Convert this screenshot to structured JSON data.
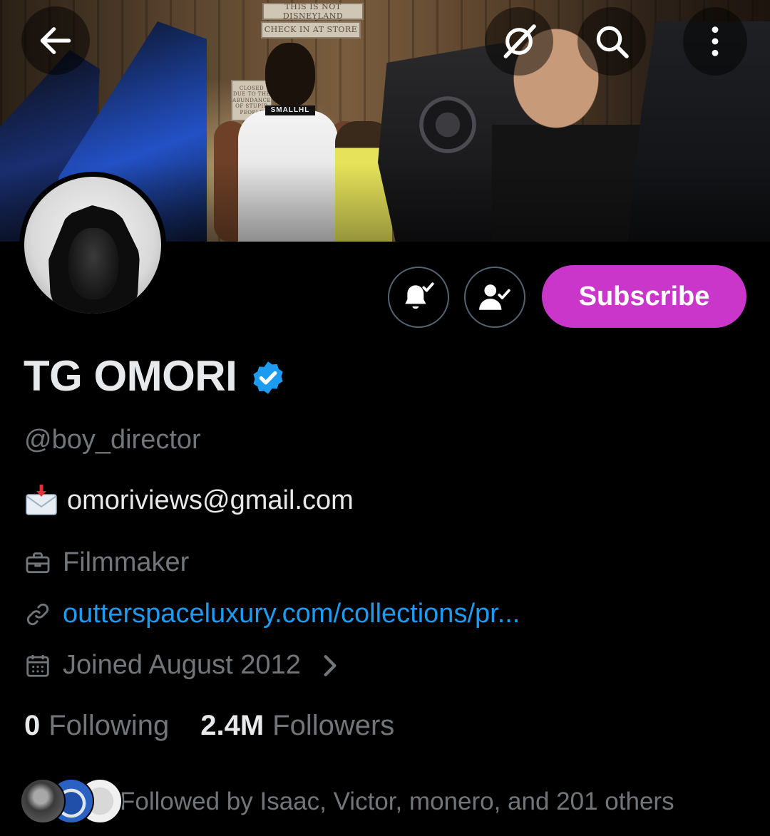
{
  "header": {
    "back_icon": "arrow-left-icon",
    "grok_icon": "grok-icon",
    "search_icon": "search-icon",
    "more_icon": "more-vertical-icon",
    "banner_sign_1": "THIS IS NOT DISNEYLAND",
    "banner_sign_2": "CHECK IN AT STORE",
    "banner_sign_3": "CLOSED DUE TO THE ABUNDANCE OF STUPID PEOPLE",
    "banner_print": "SMALLHL"
  },
  "actions": {
    "notifications_icon": "bell-check-icon",
    "following_icon": "person-check-icon",
    "subscribe_label": "Subscribe"
  },
  "profile": {
    "name": "TG OMORI",
    "verified_icon": "verified-badge-icon",
    "handle": "@boy_director",
    "bio_emoji": "incoming-envelope-emoji",
    "bio": "omoriviews@gmail.com",
    "job_icon": "briefcase-icon",
    "job": "Filmmaker",
    "link_icon": "link-icon",
    "link": "outterspaceluxury.com/collections/pr...",
    "joined_icon": "calendar-icon",
    "joined": "Joined August 2012"
  },
  "stats": {
    "following_count": "0",
    "following_label": "Following",
    "followers_count": "2.4M",
    "followers_label": "Followers"
  },
  "followed_by": {
    "text": "Followed by Isaac, Victor, monero, and 201 others"
  },
  "colors": {
    "background": "#000000",
    "primary_text": "#e7e9ea",
    "secondary_text": "#71767b",
    "link": "#1d9bf0",
    "verified": "#1d9bf0",
    "subscribe": "#c936c9",
    "border": "#536471"
  }
}
